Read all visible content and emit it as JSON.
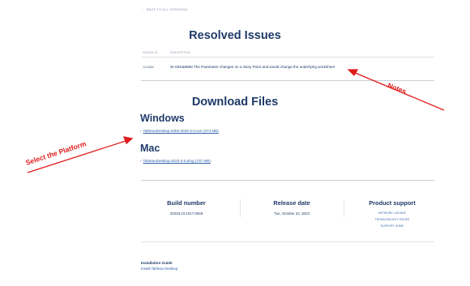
{
  "nav": {
    "back_label": "BACK TO ALL VERSIONS",
    "back_arrow": "←"
  },
  "resolved": {
    "title": "Resolved Issues",
    "columns": [
      "ISSUES ID",
      "DESCRIPTION"
    ],
    "rows": [
      {
        "id": "2019889",
        "description": "W-S5S&8868 The Parameter changes on a Story Point and would change the underlying worksheet"
      }
    ]
  },
  "download": {
    "title": "Download Files",
    "platforms": [
      {
        "name": "Windows",
        "link": "TableauDesktop-64bit-2023-3-0.exe (373 MB)"
      },
      {
        "name": "Mac",
        "link": "TableauDesktop-2023-3-0.dmg (707 MB)"
      }
    ]
  },
  "info": {
    "build": {
      "title": "Build number",
      "value": "20233.23.1017.0948"
    },
    "release": {
      "title": "Release date",
      "value": "Tue, October 24, 2023"
    },
    "support": {
      "title": "Product support",
      "links": [
        "NETWORK LICENSE",
        "TROUBLESHOOT ISSUES",
        "SUPPORT HOME"
      ]
    }
  },
  "installation": {
    "title": "Installation Guide",
    "link": "Install Tableau Desktop"
  },
  "annotations": {
    "notes": "Notes",
    "platform": "Select the Platform",
    "color": "#e01c1c"
  }
}
